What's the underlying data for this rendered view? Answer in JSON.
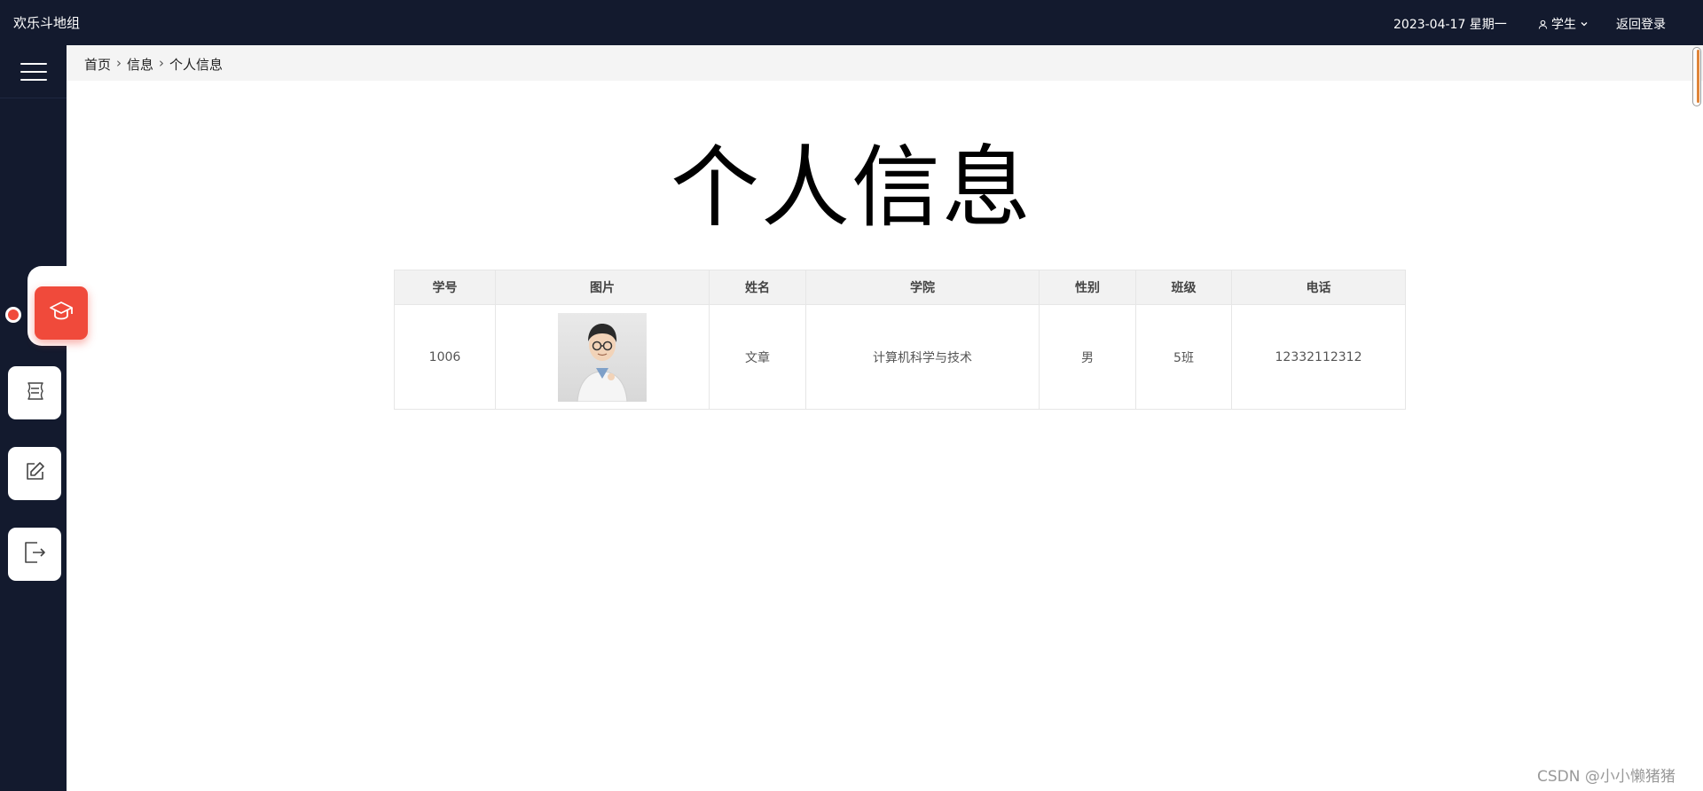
{
  "topbar": {
    "app_title": "欢乐斗地组",
    "date": "2023-04-17 星期一",
    "role": "学生",
    "back_login": "返回登录"
  },
  "sidebar": {
    "items": [
      {
        "icon": "graduation-cap-icon",
        "active": true
      },
      {
        "icon": "scroll-icon",
        "active": false
      },
      {
        "icon": "edit-icon",
        "active": false
      },
      {
        "icon": "logout-icon",
        "active": false
      }
    ]
  },
  "breadcrumb": [
    "首页",
    "信息",
    "个人信息"
  ],
  "page": {
    "title": "个人信息"
  },
  "table": {
    "headers": [
      "学号",
      "图片",
      "姓名",
      "学院",
      "性别",
      "班级",
      "电话"
    ],
    "rows": [
      {
        "id": "1006",
        "name": "文章",
        "college": "计算机科学与技术",
        "gender": "男",
        "class": "5班",
        "phone": "12332112312"
      }
    ]
  },
  "watermark": "CSDN @小小懒猪猪",
  "colors": {
    "topbar_bg": "#131a2e",
    "accent": "#f04a3b",
    "breadcrumb_bg": "#f4f4f4"
  }
}
